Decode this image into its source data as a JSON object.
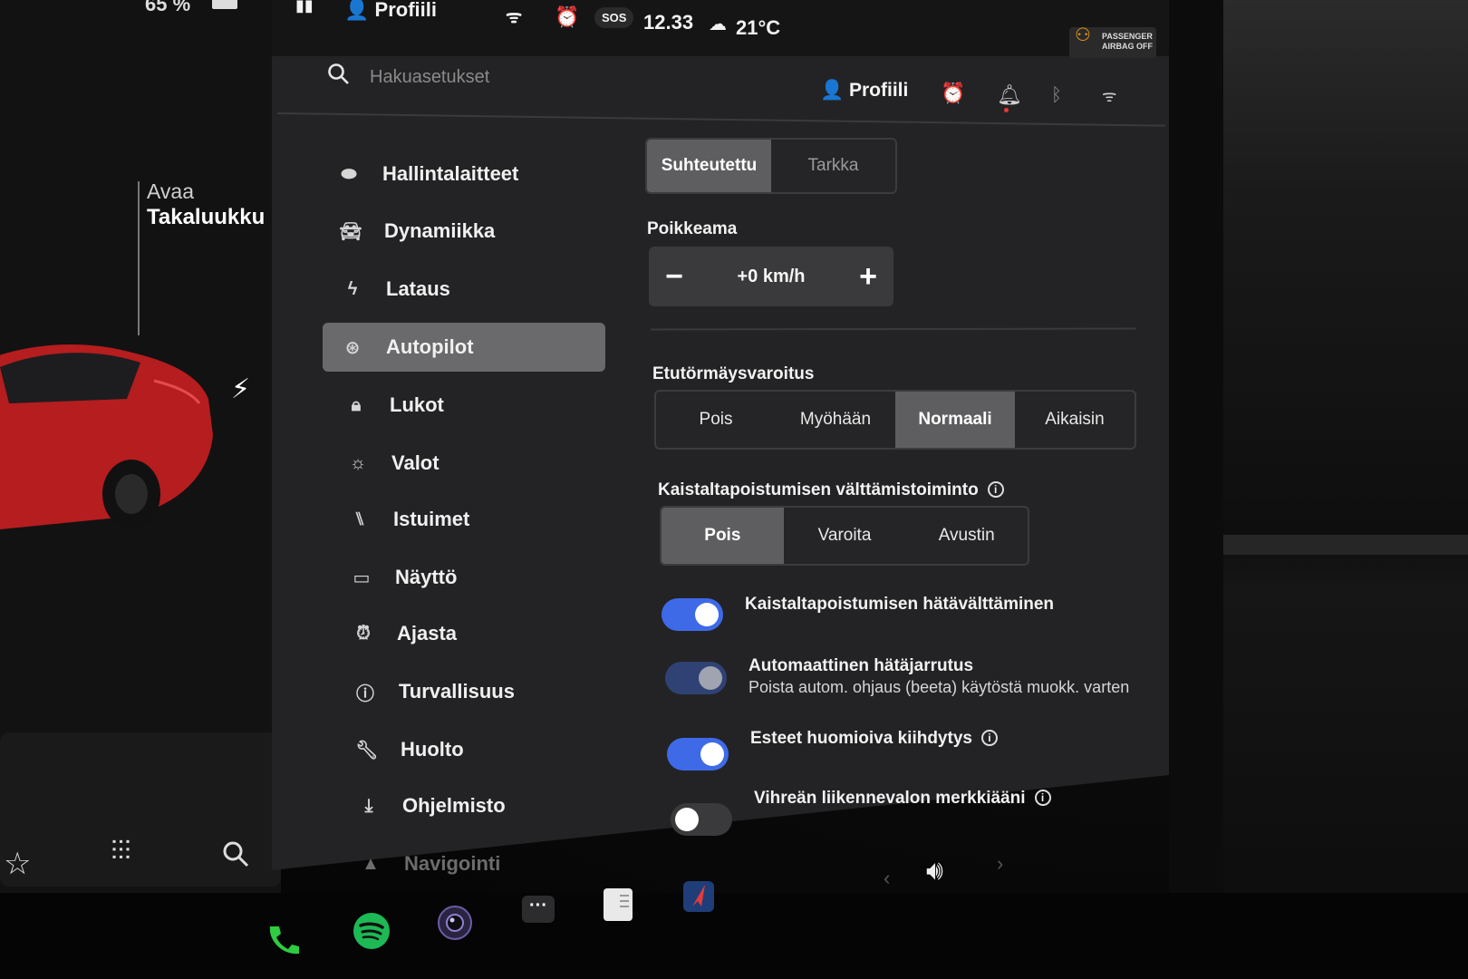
{
  "status_bar": {
    "battery": "65 %",
    "profile": "Profiili",
    "time": "12.33",
    "sos": "SOS",
    "temperature": "21°C",
    "airbag_line1": "PASSENGER",
    "airbag_line2": "AIRBAG OFF"
  },
  "car_panel": {
    "trunk_line1": "Avaa",
    "trunk_line2": "Takaluukku"
  },
  "header": {
    "search_placeholder": "Hakuasetukset",
    "profile": "Profiili"
  },
  "sidebar": {
    "items": [
      {
        "label": "Hallintalaitteet",
        "icon": "toggle-icon"
      },
      {
        "label": "Dynamiikka",
        "icon": "car-icon"
      },
      {
        "label": "Lataus",
        "icon": "bolt-icon"
      },
      {
        "label": "Autopilot",
        "icon": "steering-wheel-icon",
        "active": true
      },
      {
        "label": "Lukot",
        "icon": "lock-icon"
      },
      {
        "label": "Valot",
        "icon": "sun-icon"
      },
      {
        "label": "Istuimet",
        "icon": "seat-icon"
      },
      {
        "label": "Näyttö",
        "icon": "display-icon"
      },
      {
        "label": "Ajasta",
        "icon": "alarm-icon"
      },
      {
        "label": "Turvallisuus",
        "icon": "alert-circle-icon"
      },
      {
        "label": "Huolto",
        "icon": "wrench-icon"
      },
      {
        "label": "Ohjelmisto",
        "icon": "download-icon"
      },
      {
        "label": "Navigointi",
        "icon": "navigation-icon"
      }
    ]
  },
  "content": {
    "offset_mode": {
      "options": [
        "Suhteutettu",
        "Tarkka"
      ],
      "selected": "Suhteutettu"
    },
    "offset_label": "Poikkeama",
    "offset_value": "+0 km/h",
    "fcw_label": "Etutörmäysvaroitus",
    "fcw": {
      "options": [
        "Pois",
        "Myöhään",
        "Normaali",
        "Aikaisin"
      ],
      "selected": "Normaali"
    },
    "ldw_label": "Kaistaltapoistumisen välttämistoiminto",
    "ldw": {
      "options": [
        "Pois",
        "Varoita",
        "Avustin"
      ],
      "selected": "Pois"
    },
    "toggles": [
      {
        "label": "Kaistaltapoistumisen hätävälttäminen",
        "state": "on"
      },
      {
        "label": "Automaattinen hätäjarrutus",
        "sub": "Poista autom. ohjaus (beeta) käytöstä muokk. varten",
        "state": "disabled-on"
      },
      {
        "label": "Esteet huomioiva kiihdytys",
        "state": "on",
        "info": true
      },
      {
        "label": "Vihreän liikennevalon merkkiääni",
        "state": "off",
        "info": true
      }
    ]
  },
  "dock": {
    "apps": [
      "phone-icon",
      "spotify-icon",
      "camera-icon",
      "more-icon",
      "notes-icon",
      "navigation-app-icon"
    ]
  },
  "colors": {
    "accent_blue": "#3e6ae8",
    "selected_segment": "#5e5d5f",
    "alarm_orange": "#f39c12",
    "phone_green": "#2ecc40",
    "spotify_green": "#1db954"
  }
}
